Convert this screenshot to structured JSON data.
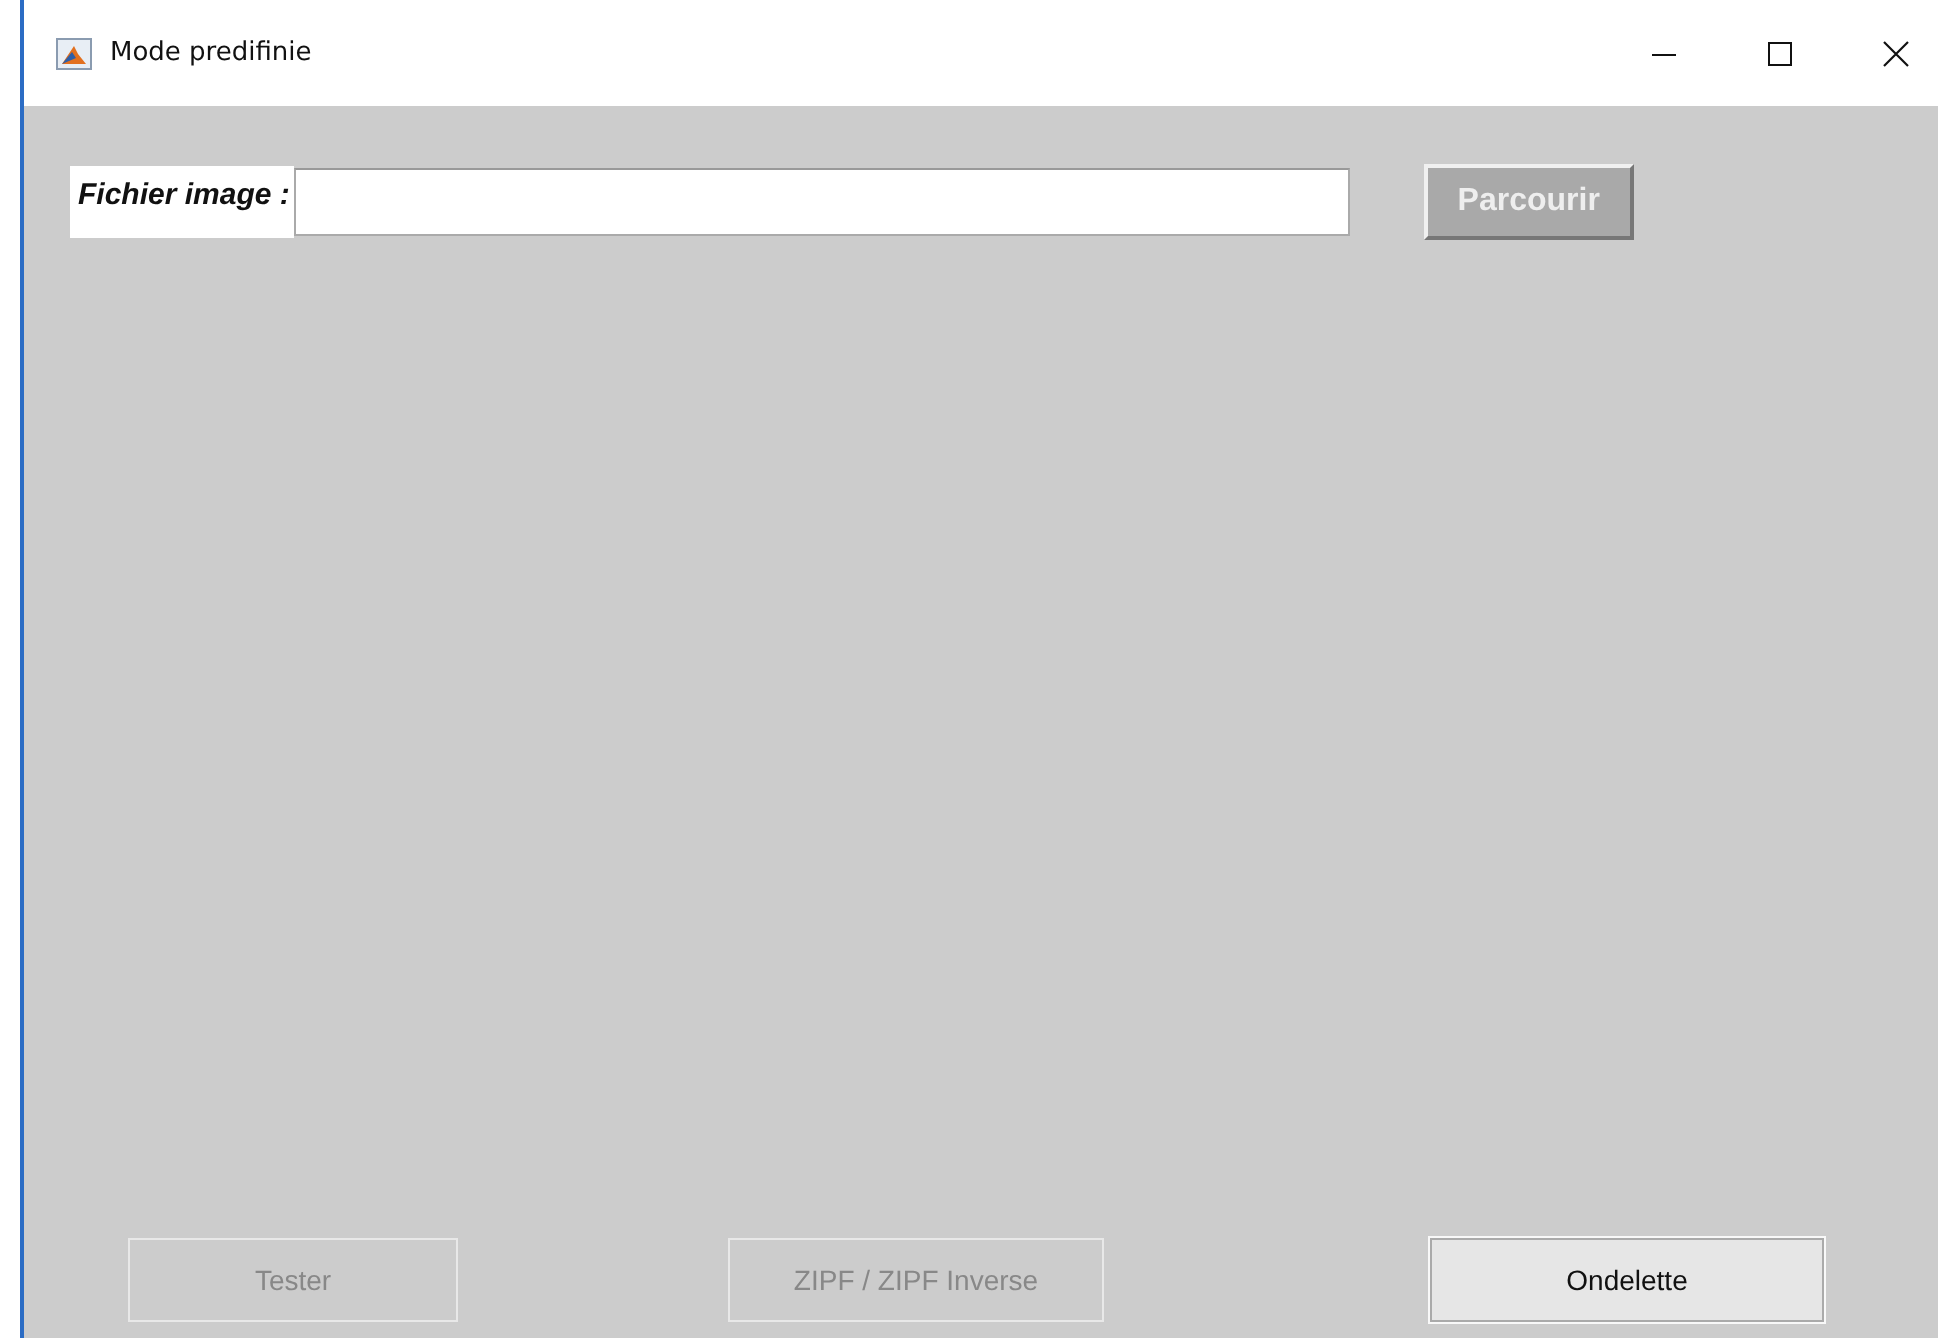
{
  "window": {
    "title": "Mode predifinie"
  },
  "file_field": {
    "label": "Fichier image :"
  },
  "browse_button": {
    "label": "Parcourir"
  },
  "buttons": [
    {
      "label": "Tester",
      "disabled": true
    },
    {
      "label": "ZIPF / ZIPF Inverse",
      "disabled": true
    },
    {
      "label": "Ondelette",
      "disabled": false
    }
  ]
}
